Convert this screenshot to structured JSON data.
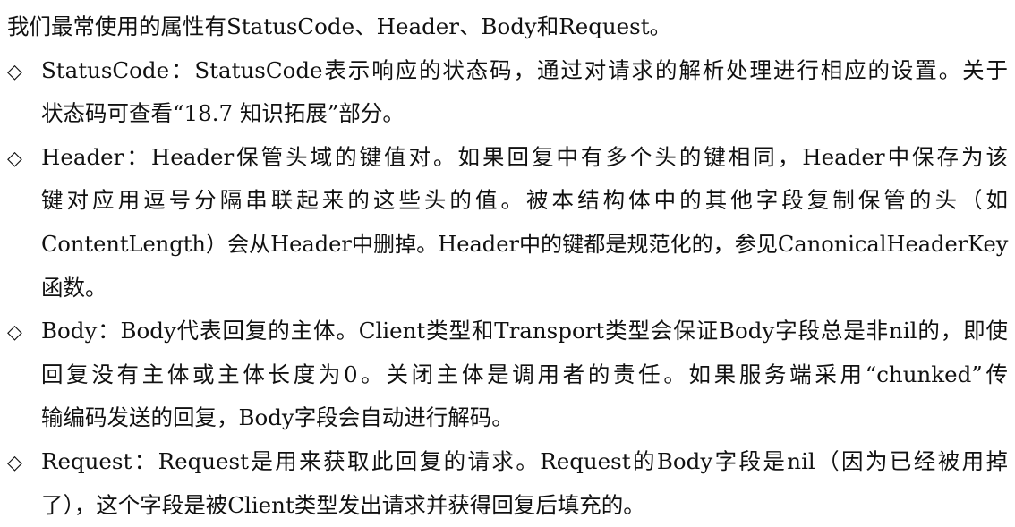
{
  "document": {
    "intro": "我们最常使用的属性有StatusCode、Header、Body和Request。",
    "bullet_symbol": "◇",
    "items": [
      {
        "lines": [
          "StatusCode：StatusCode表示响应的状态码，通过对请求的解析处理进行相应的设置。关于",
          "状态码可查看“18.7 知识拓展”部分。"
        ]
      },
      {
        "lines": [
          "Header：Header保管头域的键值对。如果回复中有多个头的键相同，Header中保存为该",
          "键对应用逗号分隔串联起来的这些头的值。被本结构体中的其他字段复制保管的头（如",
          "ContentLength）会从Header中删掉。Header中的键都是规范化的，参见CanonicalHeaderKey",
          "函数。"
        ]
      },
      {
        "lines": [
          "Body：Body代表回复的主体。Client类型和Transport类型会保证Body字段总是非nil的，即使",
          "回复没有主体或主体长度为0。关闭主体是调用者的责任。如果服务端采用“chunked”传",
          "输编码发送的回复，Body字段会自动进行解码。"
        ]
      },
      {
        "lines": [
          "Request：Request是用来获取此回复的请求。Request的Body字段是nil（因为已经被用掉",
          "了），这个字段是被Client类型发出请求并获得回复后填充的。"
        ]
      }
    ]
  }
}
